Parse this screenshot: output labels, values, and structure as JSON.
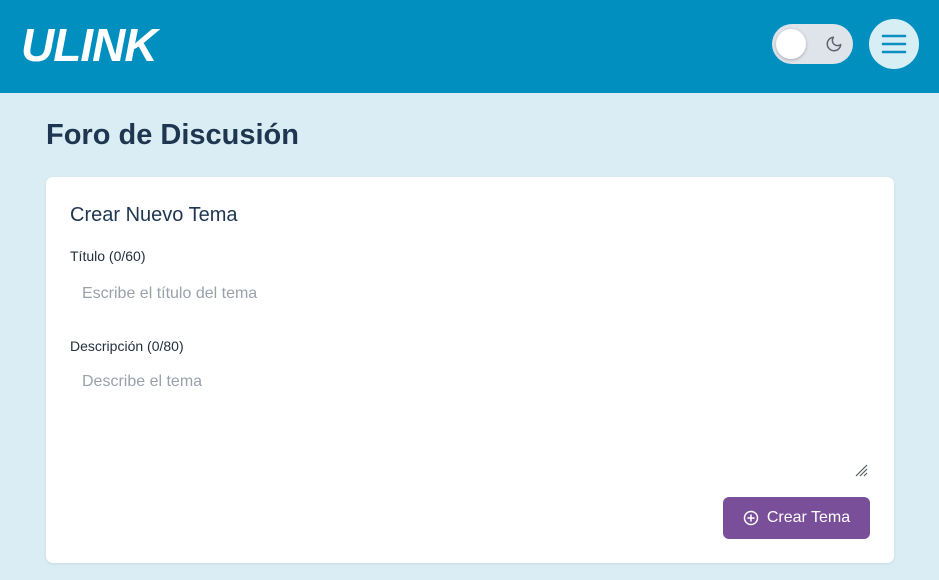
{
  "header": {
    "logo": "ULINK",
    "theme_toggle": {
      "state": "light",
      "icon": "moon-icon"
    },
    "menu_icon": "hamburger-menu-icon",
    "bg_color": "#008fbe"
  },
  "page": {
    "title": "Foro de Discusión"
  },
  "create_topic": {
    "heading": "Crear Nuevo Tema",
    "title_label": "Título (0/60)",
    "title_placeholder": "Escribe el título del tema",
    "title_value": "",
    "description_label": "Descripción (0/80)",
    "description_placeholder": "Describe el tema",
    "description_value": "",
    "submit_label": "Crear Tema",
    "submit_icon": "plus-circle-icon",
    "submit_color": "#7a4f9a"
  }
}
